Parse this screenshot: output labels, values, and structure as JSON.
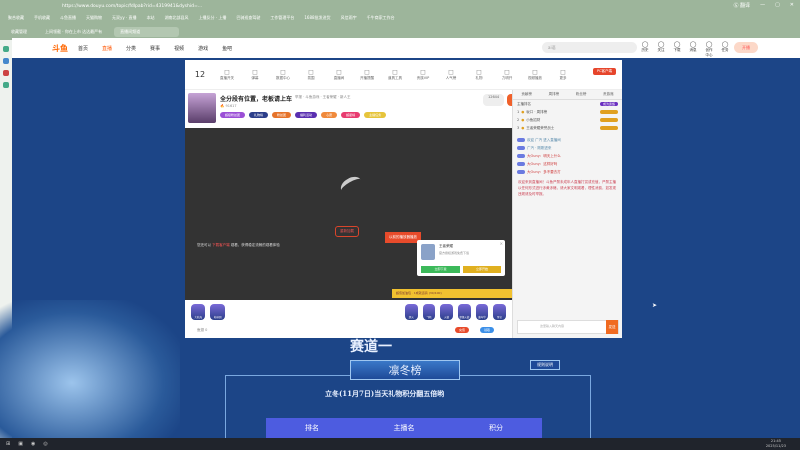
{
  "browser": {
    "url": "https://www.douyu.com/topic/fdlpab?rid=4319941&dyshid=...",
    "bookmarks": [
      "聚合收藏",
      "手机收藏",
      "斗鱼直播",
      "天猫购物",
      "无双yy · 直播",
      "本站",
      "湖南北部县风",
      "上播反分 · 上播",
      "巴骑巡查驾驶",
      "工作管理平台",
      "1688批发进货",
      "风信雨宇",
      "千牛商家工作台"
    ],
    "tabs": [
      "收藏管理",
      "上间领截 · 你在上市 达达最严有",
      "直播间频道"
    ],
    "translate": "Ⓖ 翻译"
  },
  "header": {
    "logo": "斗鱼",
    "nav": [
      "首页",
      "直播",
      "分类",
      "赛事",
      "视频",
      "游戏",
      "鱼吧"
    ],
    "search_placeholder": "ai语",
    "icons": [
      "历史",
      "关注",
      "下载",
      "消息",
      "创作中心",
      "任务"
    ],
    "live_button": "开播"
  },
  "room": {
    "level": "12",
    "toolbar": [
      "直播开关",
      "弹幕",
      "数据中心",
      "氛围",
      "直播间",
      "开播提醒",
      "道具工具",
      "贵族VIP",
      "人气榜",
      "礼物",
      "力明开",
      "视频播放",
      "更多"
    ],
    "pc_button": "PC客户端",
    "title": "全分段有位置，老板请上车",
    "meta": "举报 · 斗鱼游戏 · 王者荣耀 · 新人王",
    "hot": "91617",
    "follow_count": "12644",
    "follow_label": "关注",
    "badges": [
      {
        "t": "超级粉丝团",
        "c": "#9b4fd6"
      },
      {
        "t": "礼物榜",
        "c": "#2c3e8a"
      },
      {
        "t": "粉丝团",
        "c": "#e6742b"
      },
      {
        "t": "福利活动",
        "c": "#5a2fb0"
      },
      {
        "t": "心愿",
        "c": "#f08a3c"
      },
      {
        "t": "超星榜",
        "c": "#e83b6f"
      },
      {
        "t": "主播任务",
        "c": "#e6c43b"
      }
    ],
    "video": {
      "load_btn": "重新加载",
      "hint_pre": "您还可以 ",
      "hint_link": "下载客户端",
      "hint_post": " 观看，获得稳定流畅的观看体验",
      "tag": "以前的播放器播放",
      "game_title": "王者荣耀",
      "game_sub": "官方授权游戏免费下载",
      "btn_a": "立即下载",
      "btn_b": "立即开始",
      "promo": "超值加油包 · 1成就道具 (30/100)"
    },
    "gifts": [
      "大航海",
      "粉丝团",
      "超火",
      "飞机",
      "火箭",
      "超级火箭",
      "嘉年华",
      "梦幻"
    ],
    "wallet": "鱼翅 0",
    "send": "充值",
    "recharge": "领取",
    "chat": {
      "tabs": [
        "贡献榜",
        "周排榜",
        "粉丝榜",
        "贵族席"
      ],
      "top_label": "主播排名",
      "vip": "成为贵族",
      "users": [
        "坂口 · 周排榜",
        "小鱼招财",
        "王者荣耀荣誉战士"
      ],
      "messages": [
        "欢迎 广汽 进入直播间",
        "广汽 · 刚刚进来",
        "大Ouny：明天上什么",
        "大Ouny：这样好吗",
        "大Ouny：多不要去打"
      ],
      "notice": "欢迎来到直播间！斗鱼严禁未成年人直播打赏或充值，严禁主播以任何形式进行涉黄涉赌，请大家文明观看，理性消费，如发现违规请及时举报。",
      "input_placeholder": "这里输入聊天内容",
      "send": "发送"
    }
  },
  "event": {
    "section": "赛道一",
    "banner": "凛冬榜",
    "subtitle": "立冬(11月7日)当天礼物积分翻五倍哟",
    "rules": "规则说明",
    "cols": [
      "排名",
      "主播名",
      "积分"
    ]
  },
  "taskbar": {
    "time": "21:45",
    "date": "2025/11/23"
  }
}
